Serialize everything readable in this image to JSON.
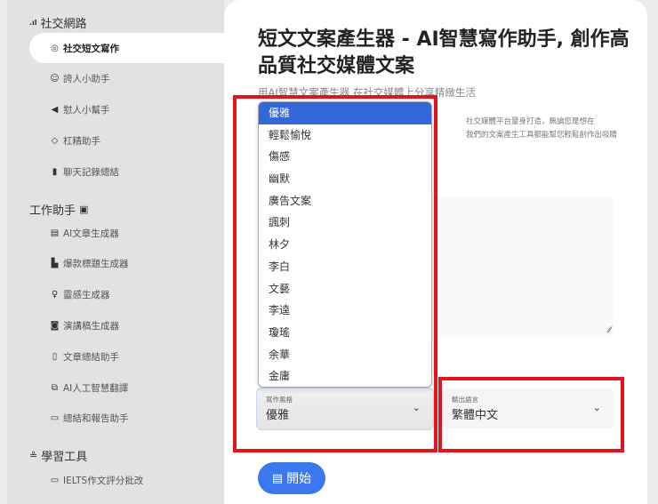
{
  "sidebar": {
    "section1": "社交網路",
    "items1": [
      "社交短文寫作",
      "誇人小助手",
      "懟人小幫手",
      "杠精助手",
      "聊天記錄總結"
    ],
    "section2": "工作助手",
    "items2": [
      "AI文章生成器",
      "爆款標題生成器",
      "靈感生成器",
      "演講稿生成器",
      "文章總結助手",
      "AI人工智慧翻譯",
      "總結和報告助手"
    ],
    "section3": "學習工具",
    "items3": [
      "IELTS作文評分批改"
    ]
  },
  "main": {
    "title": "短文文案產生器 - AI智慧寫作助手, 創作高品質社交媒體文案",
    "subtitle": "用AI智慧文案產生器 在社交媒體上分享精緻生活",
    "desc_line1": "社交媒體平台量身打造，無論您是想在",
    "desc_line2": "我們的文案產生工具都能幫您輕鬆創作出吸睛",
    "style_field": {
      "label": "寫作風格",
      "value": "優雅",
      "options": [
        "優雅",
        "輕鬆愉悅",
        "傷感",
        "幽默",
        "廣告文案",
        "諷刺",
        "林夕",
        "李白",
        "文藝",
        "李逵",
        "瓊瑤",
        "余華",
        "金庸"
      ]
    },
    "lang_field": {
      "label": "輸出語言",
      "value": "繁體中文"
    },
    "start_button": "開始"
  },
  "colors": {
    "accent": "#3b78f0",
    "highlight": "#e3151c",
    "selected": "#3366d6"
  }
}
